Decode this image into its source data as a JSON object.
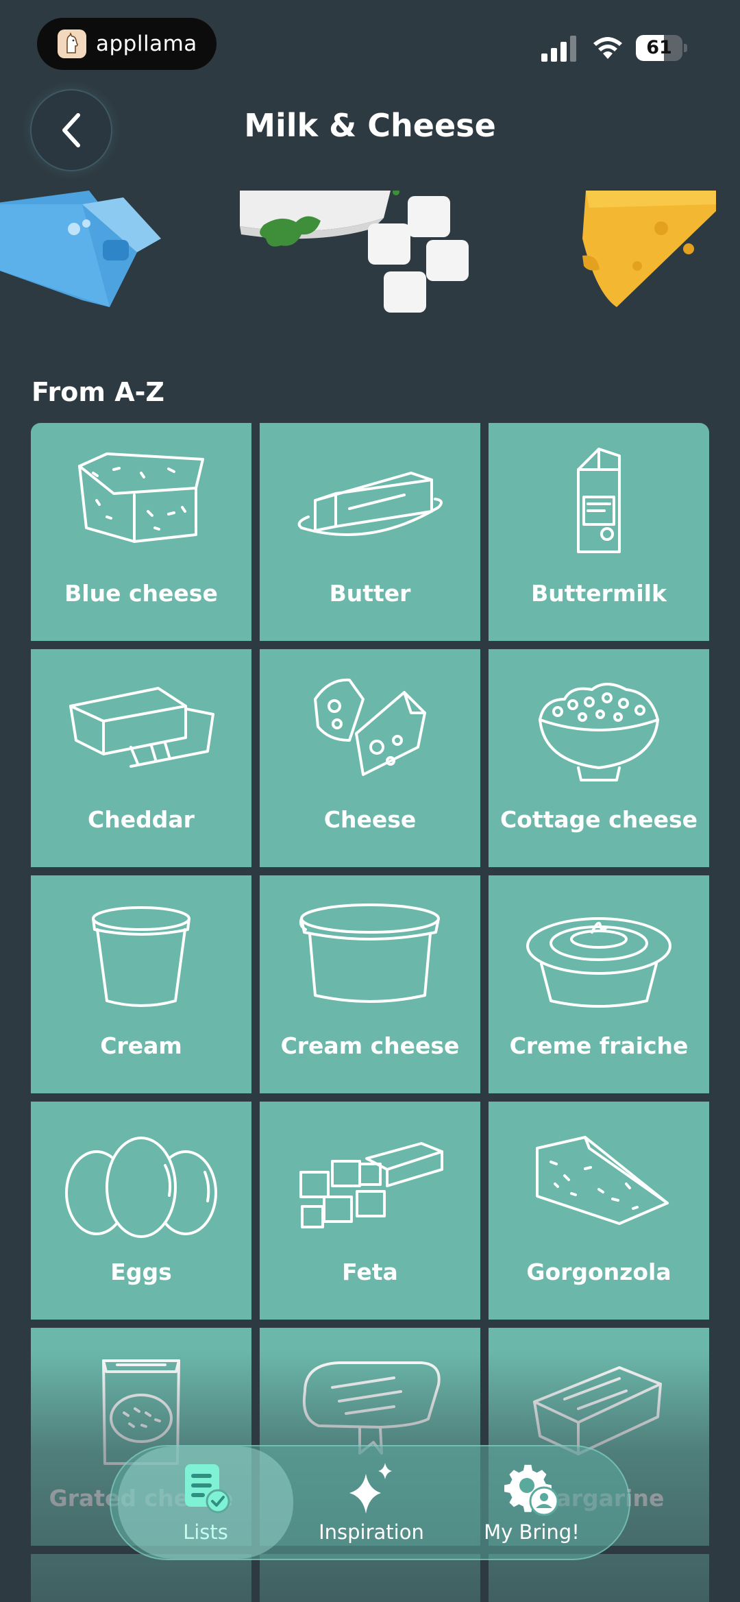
{
  "status_bar": {
    "app_name": "appllama",
    "battery_level": "61",
    "battery_fraction": 0.61
  },
  "header": {
    "title": "Milk & Cheese"
  },
  "section": {
    "heading": "From A-Z"
  },
  "items": [
    {
      "label": "Blue cheese",
      "icon": "blue-cheese-icon"
    },
    {
      "label": "Butter",
      "icon": "butter-icon"
    },
    {
      "label": "Buttermilk",
      "icon": "buttermilk-icon"
    },
    {
      "label": "Cheddar",
      "icon": "cheddar-icon"
    },
    {
      "label": "Cheese",
      "icon": "cheese-icon"
    },
    {
      "label": "Cottage cheese",
      "icon": "cottage-cheese-icon"
    },
    {
      "label": "Cream",
      "icon": "cream-icon"
    },
    {
      "label": "Cream cheese",
      "icon": "cream-cheese-icon"
    },
    {
      "label": "Creme fraiche",
      "icon": "creme-fraiche-icon"
    },
    {
      "label": "Eggs",
      "icon": "eggs-icon"
    },
    {
      "label": "Feta",
      "icon": "feta-icon"
    },
    {
      "label": "Gorgonzola",
      "icon": "gorgonzola-icon"
    },
    {
      "label": "Grated cheese",
      "icon": "grated-cheese-icon"
    },
    {
      "label": "",
      "icon": "halloumi-icon"
    },
    {
      "label": "Margarine",
      "icon": "margarine-icon"
    }
  ],
  "bottom_nav": [
    {
      "label": "Lists",
      "icon": "lists-icon",
      "active": true
    },
    {
      "label": "Inspiration",
      "icon": "sparkles-icon",
      "active": false
    },
    {
      "label": "My Bring!",
      "icon": "settings-profile-icon",
      "active": false
    }
  ],
  "colors": {
    "background": "#2e3a42",
    "tile": "#6bb7aa",
    "nav_active_label": "#c6fbf0"
  }
}
